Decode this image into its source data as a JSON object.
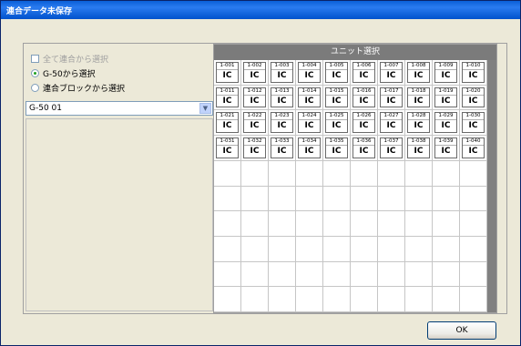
{
  "window": {
    "title": "連合データ未保存"
  },
  "options": [
    {
      "label": "全て連合から選択",
      "state": "disabled",
      "kind": "checkbox"
    },
    {
      "label": "G-50から選択",
      "state": "checked",
      "kind": "radio"
    },
    {
      "label": "連合ブロックから選択",
      "state": "unchecked",
      "kind": "radio"
    }
  ],
  "combo": {
    "value": "G-50 01",
    "arrow": "▼"
  },
  "grid": {
    "header": "ユニット選択",
    "rows": [
      [
        {
          "id": "1-001",
          "type": "IC"
        },
        {
          "id": "1-002",
          "type": "IC"
        },
        {
          "id": "1-003",
          "type": "IC"
        },
        {
          "id": "1-004",
          "type": "IC"
        },
        {
          "id": "1-005",
          "type": "IC"
        },
        {
          "id": "1-006",
          "type": "IC"
        },
        {
          "id": "1-007",
          "type": "IC"
        },
        {
          "id": "1-008",
          "type": "IC"
        },
        {
          "id": "1-009",
          "type": "IC"
        },
        {
          "id": "1-010",
          "type": "IC"
        }
      ],
      [
        {
          "id": "1-011",
          "type": "IC"
        },
        {
          "id": "1-012",
          "type": "IC"
        },
        {
          "id": "1-013",
          "type": "IC"
        },
        {
          "id": "1-014",
          "type": "IC"
        },
        {
          "id": "1-015",
          "type": "IC"
        },
        {
          "id": "1-016",
          "type": "IC"
        },
        {
          "id": "1-017",
          "type": "IC"
        },
        {
          "id": "1-018",
          "type": "IC"
        },
        {
          "id": "1-019",
          "type": "IC"
        },
        {
          "id": "1-020",
          "type": "IC"
        }
      ],
      [
        {
          "id": "1-021",
          "type": "IC"
        },
        {
          "id": "1-022",
          "type": "IC"
        },
        {
          "id": "1-023",
          "type": "IC"
        },
        {
          "id": "1-024",
          "type": "IC"
        },
        {
          "id": "1-025",
          "type": "IC"
        },
        {
          "id": "1-026",
          "type": "IC"
        },
        {
          "id": "1-027",
          "type": "IC"
        },
        {
          "id": "1-028",
          "type": "IC"
        },
        {
          "id": "1-029",
          "type": "IC"
        },
        {
          "id": "1-030",
          "type": "IC"
        }
      ],
      [
        {
          "id": "1-031",
          "type": "IC"
        },
        {
          "id": "1-032",
          "type": "IC"
        },
        {
          "id": "1-033",
          "type": "IC"
        },
        {
          "id": "1-034",
          "type": "IC"
        },
        {
          "id": "1-035",
          "type": "IC"
        },
        {
          "id": "1-036",
          "type": "IC"
        },
        {
          "id": "1-037",
          "type": "IC"
        },
        {
          "id": "1-038",
          "type": "IC"
        },
        {
          "id": "1-039",
          "type": "IC"
        },
        {
          "id": "1-040",
          "type": "IC"
        }
      ]
    ]
  },
  "ok_button": {
    "label": "OK"
  }
}
